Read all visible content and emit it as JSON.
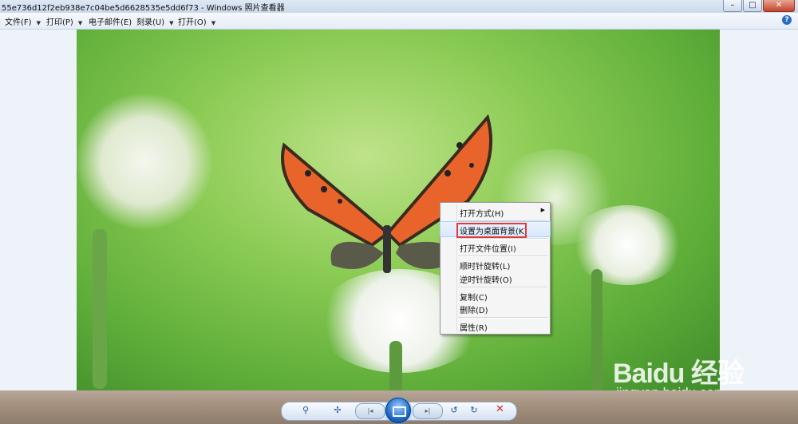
{
  "window": {
    "title": "55e736d12f2eb938e7c04be5d6628535e5dd6f73 - Windows 照片查看器",
    "minimize": "–",
    "maximize": "□",
    "close": "✕"
  },
  "menubar": {
    "items": [
      {
        "label": "文件(F)"
      },
      {
        "label": "打印(P)"
      },
      {
        "label": "电子邮件(E)"
      },
      {
        "label": "刻录(U)"
      },
      {
        "label": "打开(O)"
      }
    ],
    "help": "?"
  },
  "context_menu": {
    "items": [
      {
        "label": "打开方式(H)",
        "has_submenu": true
      },
      {
        "label": "设置为桌面背景(K)",
        "highlighted": true
      },
      {
        "label": "打开文件位置(I)"
      },
      {
        "label": "顺时针旋转(L)"
      },
      {
        "label": "逆时针旋转(O)"
      },
      {
        "label": "复制(C)"
      },
      {
        "label": "删除(D)"
      },
      {
        "label": "属性(R)"
      }
    ]
  },
  "toolbar": {
    "zoom": "⚲",
    "actual_size": "✢",
    "previous": "|◂",
    "next": "▸|",
    "rotate_ccw": "↺",
    "rotate_cw": "↻",
    "delete": "✕"
  },
  "watermark": {
    "brand": "Baidu 经验",
    "url": "jingyan.baidu.com"
  }
}
